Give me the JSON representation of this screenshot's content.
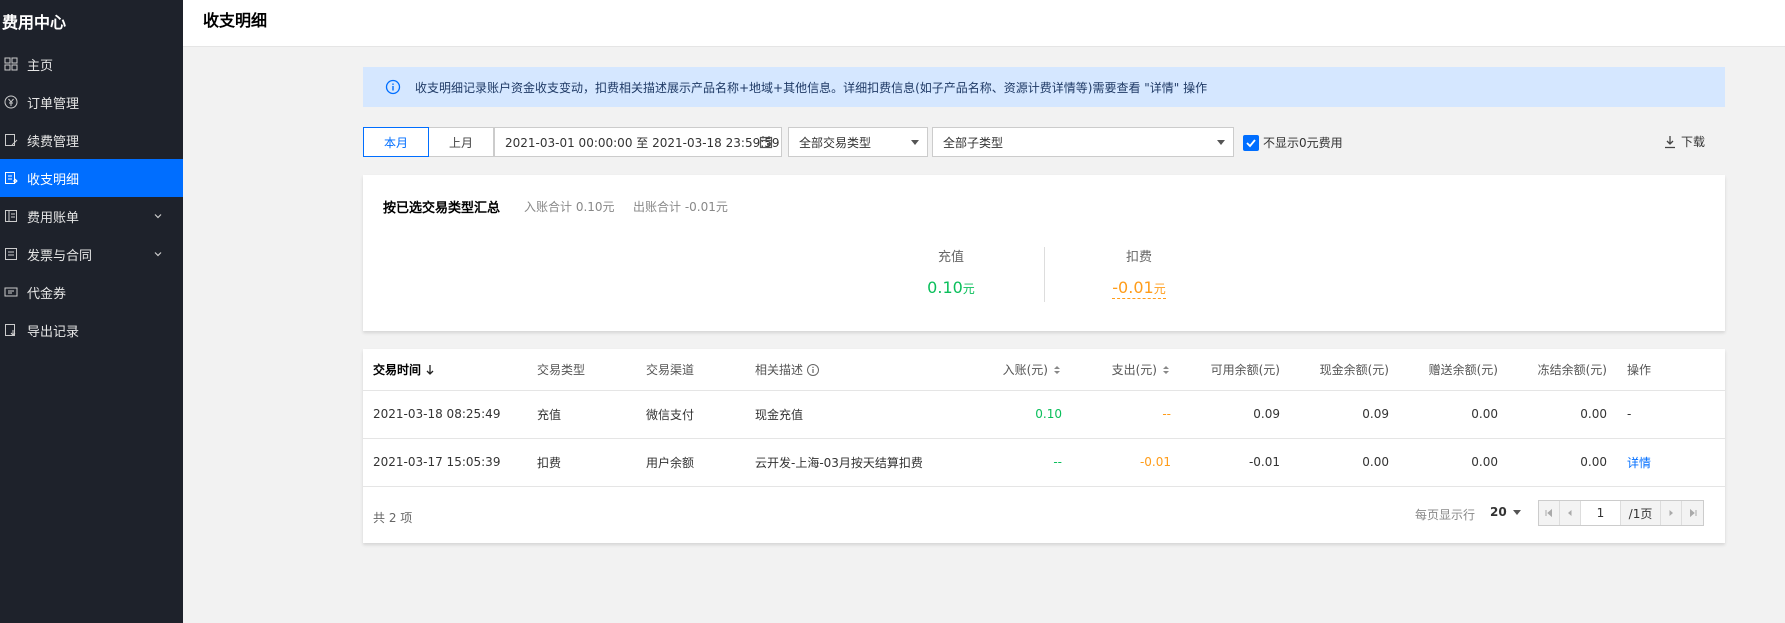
{
  "sidebar": {
    "title": "费用中心",
    "items": [
      {
        "label": "主页"
      },
      {
        "label": "订单管理"
      },
      {
        "label": "续费管理"
      },
      {
        "label": "收支明细"
      },
      {
        "label": "费用账单"
      },
      {
        "label": "发票与合同"
      },
      {
        "label": "代金券"
      },
      {
        "label": "导出记录"
      }
    ],
    "active_index": 3
  },
  "header": {
    "title": "收支明细"
  },
  "notice": {
    "text": "收支明细记录账户资金收支变动，扣费相关描述展示产品名称+地域+其他信息。详细扣费信息(如子产品名称、资源计费详情等)需要查看 \"详情\" 操作"
  },
  "toolbar": {
    "this_month": "本月",
    "last_month": "上月",
    "date_range": "2021-03-01 00:00:00 至 2021-03-18 23:59:59",
    "trade_type": "全部交易类型",
    "sub_type": "全部子类型",
    "hide_zero_label": "不显示0元费用",
    "download_label": "下载"
  },
  "summary": {
    "title": "按已选交易类型汇总",
    "income_total": "入账合计 0.10元",
    "expense_total": "出账合计 -0.01元",
    "recharge_label": "充值",
    "recharge_value": "0.10",
    "deduct_label": "扣费",
    "deduct_value": "-0.01",
    "unit": "元"
  },
  "table": {
    "headers": {
      "time": "交易时间",
      "type": "交易类型",
      "channel": "交易渠道",
      "desc": "相关描述",
      "income": "入账(元)",
      "expense": "支出(元)",
      "available": "可用余额(元)",
      "cash": "现金余额(元)",
      "gift": "赠送余额(元)",
      "frozen": "冻结余额(元)",
      "action": "操作"
    },
    "rows": [
      {
        "time": "2021-03-18 08:25:49",
        "type": "充值",
        "channel": "微信支付",
        "desc": "现金充值",
        "income": "0.10",
        "expense": "--",
        "available": "0.09",
        "cash": "0.09",
        "gift": "0.00",
        "frozen": "0.00",
        "action": "-"
      },
      {
        "time": "2021-03-17 15:05:39",
        "type": "扣费",
        "channel": "用户余额",
        "desc": "云开发-上海-03月按天结算扣费",
        "income": "--",
        "expense": "-0.01",
        "available": "-0.01",
        "cash": "0.00",
        "gift": "0.00",
        "frozen": "0.00",
        "action": "详情"
      }
    ]
  },
  "footer": {
    "total": "共 2 项",
    "page_size_label": "每页显示行",
    "page_size": "20",
    "current_page": "1",
    "total_pages": "/1页"
  },
  "colors": {
    "accent": "#006eff",
    "sidebar_bg": "#1e222b",
    "green": "#0abf5b",
    "orange": "#ff9c19",
    "notice_bg": "#d5e7ff"
  }
}
